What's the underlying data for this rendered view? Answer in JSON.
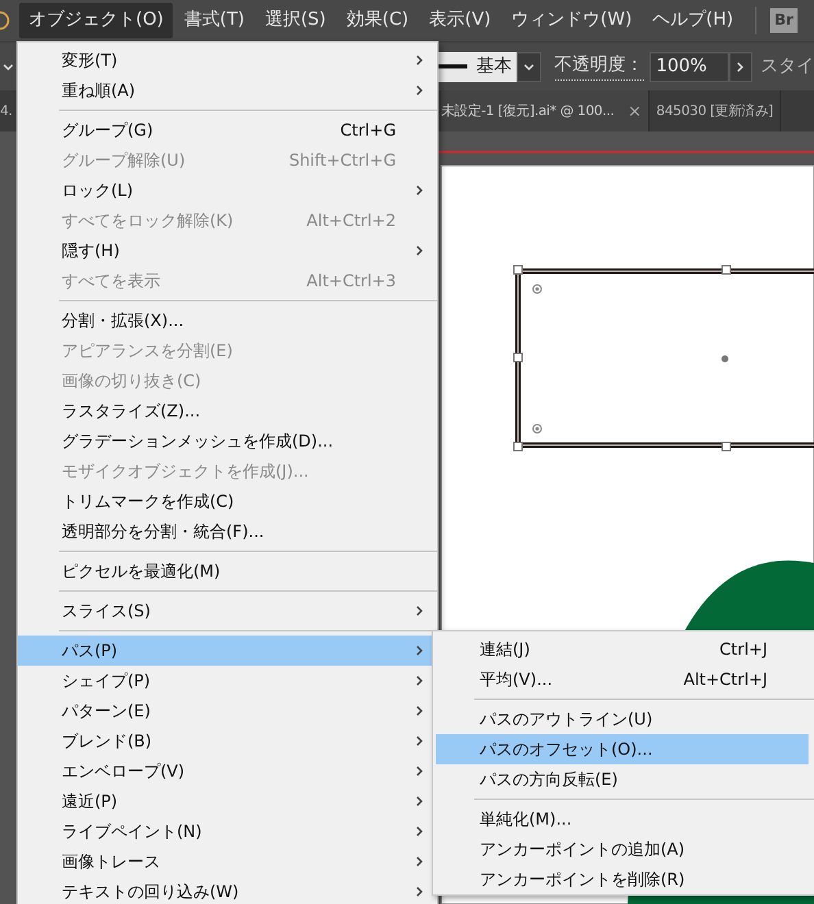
{
  "menubar": {
    "items": [
      {
        "label": "オブジェクト(O)",
        "selected": true
      },
      {
        "label": "書式(T)",
        "selected": false
      },
      {
        "label": "選択(S)",
        "selected": false
      },
      {
        "label": "効果(C)",
        "selected": false
      },
      {
        "label": "表示(V)",
        "selected": false
      },
      {
        "label": "ウィンドウ(W)",
        "selected": false
      },
      {
        "label": "ヘルプ(H)",
        "selected": false
      }
    ],
    "bridge_button": "Br"
  },
  "control_bar": {
    "stroke_profile": "基本",
    "opacity_label": "不透明度：",
    "opacity_value": "100%",
    "style_label": "スタイ"
  },
  "document_tabs": [
    {
      "label": "4.",
      "selected": false
    },
    {
      "label": "未設定-1 [復元].ai* @ 100...",
      "selected": true,
      "close": "×"
    },
    {
      "label": "845030 [更新済み]",
      "selected": false
    }
  ],
  "object_menu": {
    "items": [
      {
        "kind": "item",
        "label": "変形(T)",
        "submenu": true,
        "disabled": false,
        "selected": false
      },
      {
        "kind": "item",
        "label": "重ね順(A)",
        "submenu": true,
        "disabled": false,
        "selected": false
      },
      {
        "kind": "separator"
      },
      {
        "kind": "item",
        "label": "グループ(G)",
        "shortcut": "Ctrl+G",
        "submenu": false,
        "disabled": false,
        "selected": false
      },
      {
        "kind": "item",
        "label": "グループ解除(U)",
        "shortcut": "Shift+Ctrl+G",
        "submenu": false,
        "disabled": true,
        "selected": false
      },
      {
        "kind": "item",
        "label": "ロック(L)",
        "submenu": true,
        "disabled": false,
        "selected": false
      },
      {
        "kind": "item",
        "label": "すべてをロック解除(K)",
        "shortcut": "Alt+Ctrl+2",
        "submenu": false,
        "disabled": true,
        "selected": false
      },
      {
        "kind": "item",
        "label": "隠す(H)",
        "submenu": true,
        "disabled": false,
        "selected": false
      },
      {
        "kind": "item",
        "label": "すべてを表示",
        "shortcut": "Alt+Ctrl+3",
        "submenu": false,
        "disabled": true,
        "selected": false
      },
      {
        "kind": "separator"
      },
      {
        "kind": "item",
        "label": "分割・拡張(X)...",
        "submenu": false,
        "disabled": false,
        "selected": false
      },
      {
        "kind": "item",
        "label": "アピアランスを分割(E)",
        "submenu": false,
        "disabled": true,
        "selected": false
      },
      {
        "kind": "item",
        "label": "画像の切り抜き(C)",
        "submenu": false,
        "disabled": true,
        "selected": false
      },
      {
        "kind": "item",
        "label": "ラスタライズ(Z)...",
        "submenu": false,
        "disabled": false,
        "selected": false
      },
      {
        "kind": "item",
        "label": "グラデーションメッシュを作成(D)...",
        "submenu": false,
        "disabled": false,
        "selected": false
      },
      {
        "kind": "item",
        "label": "モザイクオブジェクトを作成(J)...",
        "submenu": false,
        "disabled": true,
        "selected": false
      },
      {
        "kind": "item",
        "label": "トリムマークを作成(C)",
        "submenu": false,
        "disabled": false,
        "selected": false
      },
      {
        "kind": "item",
        "label": "透明部分を分割・統合(F)...",
        "submenu": false,
        "disabled": false,
        "selected": false
      },
      {
        "kind": "separator"
      },
      {
        "kind": "item",
        "label": "ピクセルを最適化(M)",
        "submenu": false,
        "disabled": false,
        "selected": false
      },
      {
        "kind": "separator"
      },
      {
        "kind": "item",
        "label": "スライス(S)",
        "submenu": true,
        "disabled": false,
        "selected": false
      },
      {
        "kind": "separator"
      },
      {
        "kind": "item",
        "label": "パス(P)",
        "submenu": true,
        "disabled": false,
        "selected": true
      },
      {
        "kind": "item",
        "label": "シェイプ(P)",
        "submenu": true,
        "disabled": false,
        "selected": false
      },
      {
        "kind": "item",
        "label": "パターン(E)",
        "submenu": true,
        "disabled": false,
        "selected": false
      },
      {
        "kind": "item",
        "label": "ブレンド(B)",
        "submenu": true,
        "disabled": false,
        "selected": false
      },
      {
        "kind": "item",
        "label": "エンベロープ(V)",
        "submenu": true,
        "disabled": false,
        "selected": false
      },
      {
        "kind": "item",
        "label": "遠近(P)",
        "submenu": true,
        "disabled": false,
        "selected": false
      },
      {
        "kind": "item",
        "label": "ライブペイント(N)",
        "submenu": true,
        "disabled": false,
        "selected": false
      },
      {
        "kind": "item",
        "label": "画像トレース",
        "submenu": true,
        "disabled": false,
        "selected": false
      },
      {
        "kind": "item",
        "label": "テキストの回り込み(W)",
        "submenu": true,
        "disabled": false,
        "selected": false
      }
    ]
  },
  "path_submenu": {
    "items": [
      {
        "kind": "item",
        "label": "連結(J)",
        "shortcut": "Ctrl+J",
        "selected": false
      },
      {
        "kind": "item",
        "label": "平均(V)...",
        "shortcut": "Alt+Ctrl+J",
        "selected": false
      },
      {
        "kind": "separator"
      },
      {
        "kind": "item",
        "label": "パスのアウトライン(U)",
        "selected": false
      },
      {
        "kind": "item",
        "label": "パスのオフセット(O)...",
        "selected": true
      },
      {
        "kind": "item",
        "label": "パスの方向反転(E)",
        "selected": false
      },
      {
        "kind": "separator"
      },
      {
        "kind": "item",
        "label": "単純化(M)...",
        "selected": false
      },
      {
        "kind": "item",
        "label": "アンカーポイントの追加(A)",
        "selected": false
      },
      {
        "kind": "item",
        "label": "アンカーポイントを削除(R)",
        "selected": false
      }
    ]
  }
}
